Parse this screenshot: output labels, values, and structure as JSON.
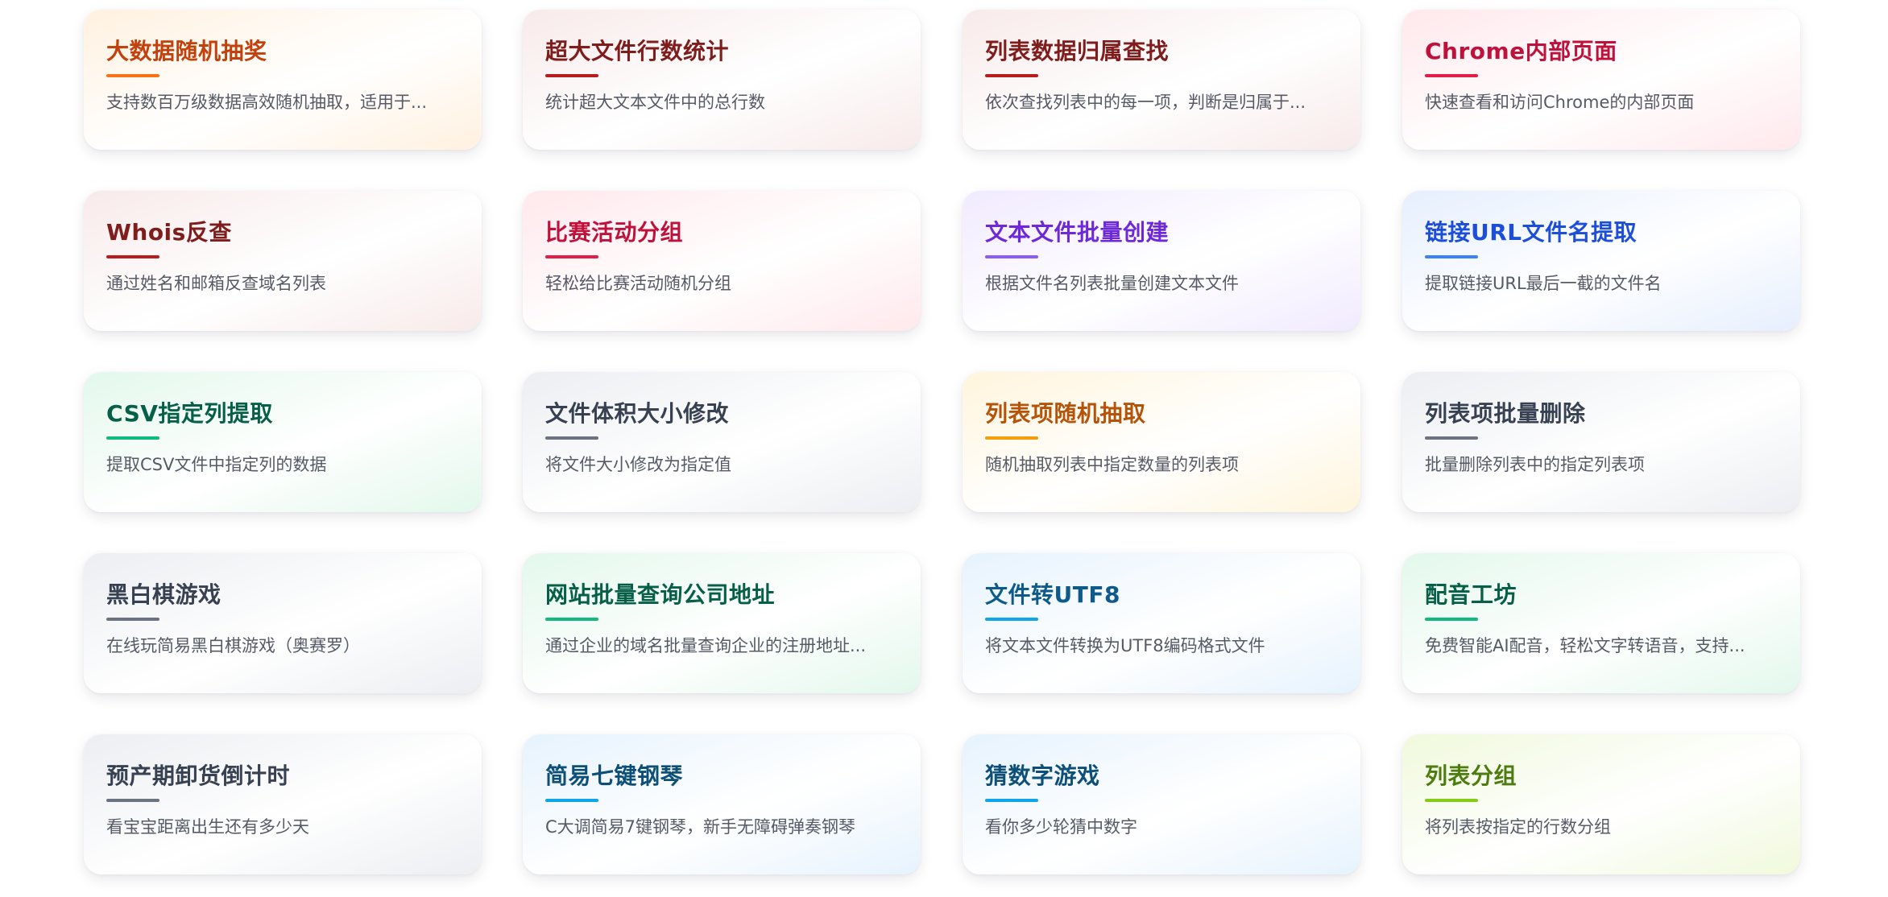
{
  "cards": [
    {
      "title": "大数据随机抽奖",
      "desc": "支持数百万级数据高效随机抽取，适用于...",
      "color": "#c2410c",
      "accent": "#f97316",
      "tint": "#fff1e0"
    },
    {
      "title": "超大文件行数统计",
      "desc": "统计超大文本文件中的总行数",
      "color": "#7f1d1d",
      "accent": "#b91c1c",
      "tint": "#f8eaea"
    },
    {
      "title": "列表数据归属查找",
      "desc": "依次查找列表中的每一项，判断是归属于...",
      "color": "#7f1d1d",
      "accent": "#b91c1c",
      "tint": "#f8eaea"
    },
    {
      "title": "Chrome内部页面",
      "desc": "快速查看和访问Chrome的内部页面",
      "color": "#be123c",
      "accent": "#e11d48",
      "tint": "#ffe8ec"
    },
    {
      "title": "Whois反查",
      "desc": "通过姓名和邮箱反查域名列表",
      "color": "#7f1d1d",
      "accent": "#b91c1c",
      "tint": "#f8eaea"
    },
    {
      "title": "比赛活动分组",
      "desc": "轻松给比赛活动随机分组",
      "color": "#be123c",
      "accent": "#e11d48",
      "tint": "#ffe8ec"
    },
    {
      "title": "文本文件批量创建",
      "desc": "根据文件名列表批量创建文本文件",
      "color": "#6d28d9",
      "accent": "#8b5cf6",
      "tint": "#f1eaff"
    },
    {
      "title": "链接URL文件名提取",
      "desc": "提取链接URL最后一截的文件名",
      "color": "#1d4ed8",
      "accent": "#3b82f6",
      "tint": "#e6effe"
    },
    {
      "title": "CSV指定列提取",
      "desc": "提取CSV文件中指定列的数据",
      "color": "#065f46",
      "accent": "#10b981",
      "tint": "#e3f8ec"
    },
    {
      "title": "文件体积大小修改",
      "desc": "将文件大小修改为指定值",
      "color": "#374151",
      "accent": "#6b7280",
      "tint": "#eceef2"
    },
    {
      "title": "列表项随机抽取",
      "desc": "随机抽取列表中指定数量的列表项",
      "color": "#b45309",
      "accent": "#f59e0b",
      "tint": "#fff5dd"
    },
    {
      "title": "列表项批量删除",
      "desc": "批量删除列表中的指定列表项",
      "color": "#374151",
      "accent": "#6b7280",
      "tint": "#eceef2"
    },
    {
      "title": "黑白棋游戏",
      "desc": "在线玩简易黑白棋游戏（奥赛罗）",
      "color": "#374151",
      "accent": "#6b7280",
      "tint": "#eceef2"
    },
    {
      "title": "网站批量查询公司地址",
      "desc": "通过企业的域名批量查询企业的注册地址...",
      "color": "#065f46",
      "accent": "#10b981",
      "tint": "#e3f8ec"
    },
    {
      "title": "文件转UTF8",
      "desc": "将文本文件转换为UTF8编码格式文件",
      "color": "#0e5a8a",
      "accent": "#0ea5e9",
      "tint": "#e6f3fd"
    },
    {
      "title": "配音工坊",
      "desc": "免费智能AI配音，轻松文字转语音，支持...",
      "color": "#065f46",
      "accent": "#10b981",
      "tint": "#e3f8ec"
    },
    {
      "title": "预产期卸货倒计时",
      "desc": "看宝宝距离出生还有多少天",
      "color": "#374151",
      "accent": "#6b7280",
      "tint": "#eceef2"
    },
    {
      "title": "简易七键钢琴",
      "desc": "C大调简易7键钢琴，新手无障碍弹奏钢琴",
      "color": "#0e4f78",
      "accent": "#0ea5e9",
      "tint": "#e6f3fd"
    },
    {
      "title": "猜数字游戏",
      "desc": "看你多少轮猜中数字",
      "color": "#0e4f78",
      "accent": "#0ea5e9",
      "tint": "#e6f3fd"
    },
    {
      "title": "列表分组",
      "desc": "将列表按指定的行数分组",
      "color": "#4d7c0f",
      "accent": "#84cc16",
      "tint": "#f0f9dc"
    }
  ]
}
